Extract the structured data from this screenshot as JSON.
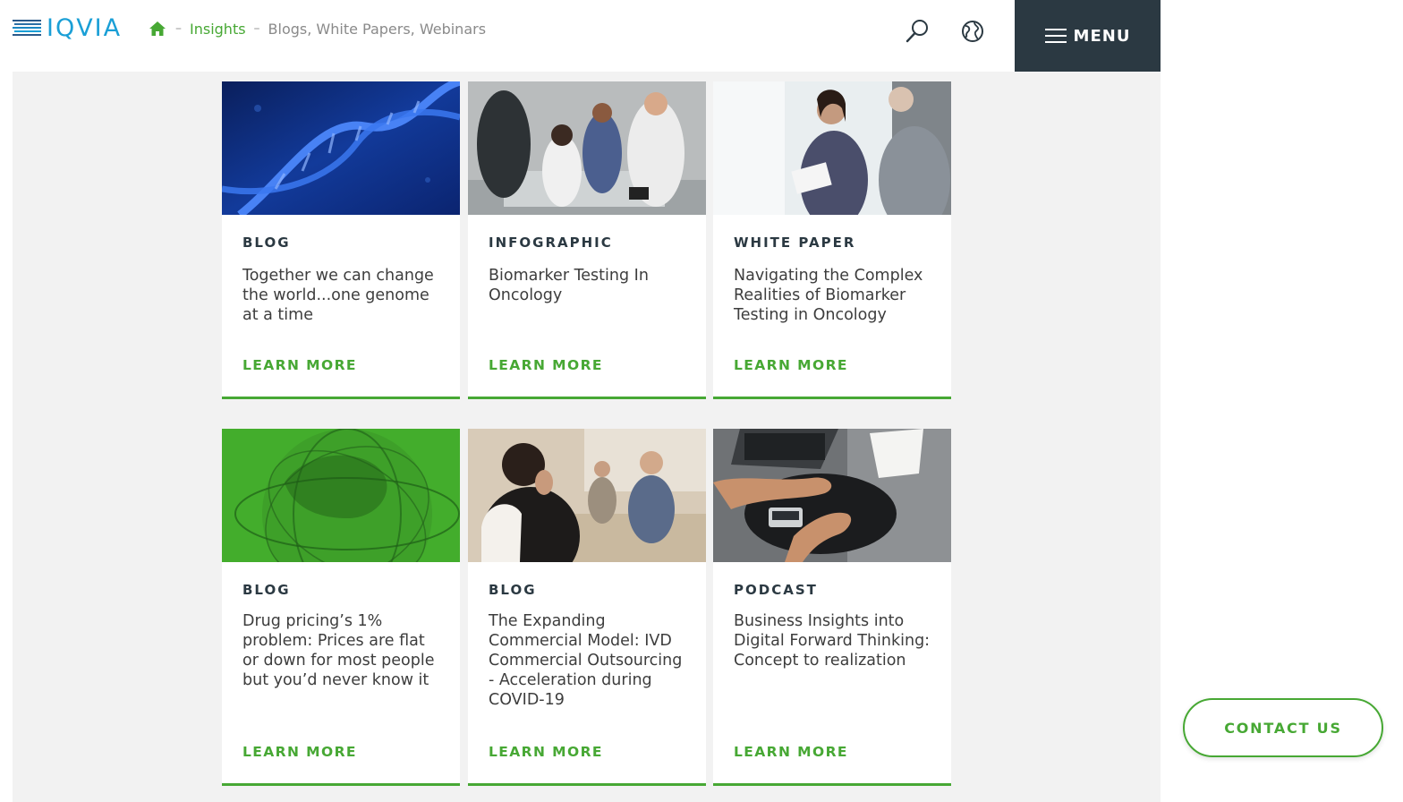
{
  "brand": {
    "name": "IQVIA",
    "accent": "#47a834",
    "logo_blue": "#1a9fd6",
    "menu_bg": "#2b3942"
  },
  "breadcrumb": {
    "home_icon": "home-icon",
    "separator": "–",
    "items": [
      {
        "label": "Insights"
      },
      {
        "label": "Blogs, White Papers, Webinars"
      }
    ]
  },
  "header": {
    "search_icon": "search-icon",
    "globe_icon": "globe-icon",
    "menu_label": "MENU"
  },
  "cards": [
    {
      "type": "BLOG",
      "title": "Together we can change the world...one genome at a time",
      "link": "LEARN MORE",
      "image": "dna-helix-image"
    },
    {
      "type": "INFOGRAPHIC",
      "title": "Biomarker Testing In Oncology",
      "link": "LEARN MORE",
      "image": "doctors-meeting-image"
    },
    {
      "type": "WHITE PAPER",
      "title": "Navigating the Complex Realities of Biomarker Testing in Oncology",
      "link": "LEARN MORE",
      "image": "nurse-patient-image"
    },
    {
      "type": "BLOG",
      "title": "Drug pricing’s 1% problem: Prices are flat or down for most people but you’d never know it",
      "link": "LEARN MORE",
      "image": "green-globe-image"
    },
    {
      "type": "BLOG",
      "title": "The Expanding Commercial Model: IVD Commercial Outsourcing - Acceleration during COVID-19",
      "link": "LEARN MORE",
      "image": "business-meeting-image"
    },
    {
      "type": "PODCAST",
      "title": "Business Insights into Digital Forward Thinking: Concept to realization",
      "link": "LEARN MORE",
      "image": "glucose-meter-image"
    }
  ],
  "contact": {
    "label": "CONTACT US"
  }
}
